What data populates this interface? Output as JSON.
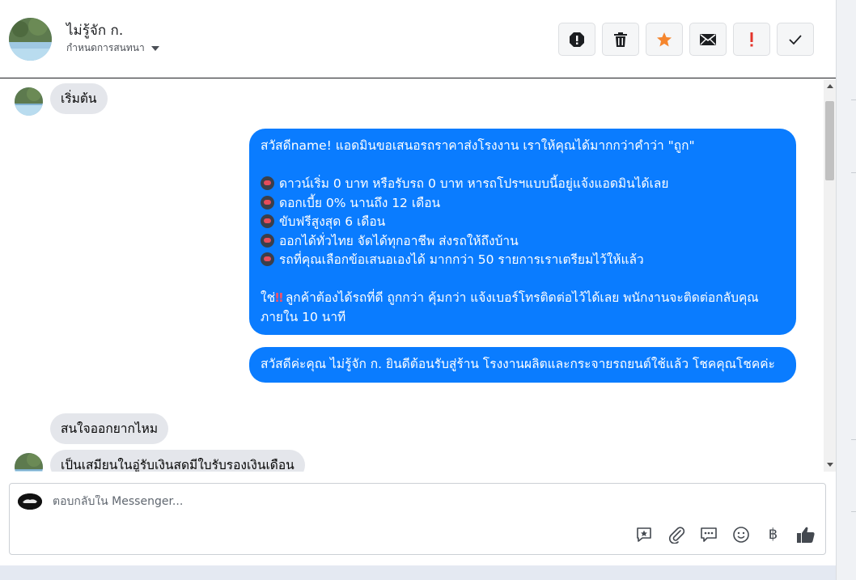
{
  "contact": {
    "name": "ไม่รู้จัก ก.",
    "assign_label": "กำหนดการสนทนา"
  },
  "actions": [
    {
      "name": "spam-icon",
      "color": "#1c1e21"
    },
    {
      "name": "trash-icon",
      "color": "#1c1e21"
    },
    {
      "name": "star-icon",
      "color": "#f5862e"
    },
    {
      "name": "mail-icon",
      "color": "#1c1e21"
    },
    {
      "name": "exclamation-icon",
      "color": "#e4342b"
    },
    {
      "name": "check-icon",
      "color": "#1c1e21"
    }
  ],
  "messages": {
    "m1": "เริ่มต้น",
    "m2": {
      "l1": "สวัสดีname! แอดมินขอเสนอรถราคาส่งโรงงาน เราให้คุณได้มากกว่าคำว่า \"ถูก\"",
      "l2": "ดาวน์เริ่ม 0 บาท หรือรับรถ 0 บาท หารถโปรฯแบบนี้อยู่แจ้งแอดมินได้เลย",
      "l3": "ดอกเบี้ย 0% นานถึง 12 เดือน",
      "l4": "ขับฟรีสูงสุด 6 เดือน",
      "l5": "ออกได้ทั่วไทย จัดได้ทุกอาชีพ ส่งรถให้ถึงบ้าน",
      "l6": "รถที่คุณเลือกข้อเสนอเองได้ มากกว่า 50 รายการเราเตรียมไว้ให้แล้ว",
      "l7a": "ใช่",
      "l7b": "ลูกค้าต้องได้รถที่ดี ถูกกว่า คุ้มกว่า แจ้งเบอร์โทรติดต่อไว้ได้เลย พนักงานจะติดต่อกลับคุณภายใน 10 นาที"
    },
    "m3": "สวัสดีค่ะคุณ ไม่รู้จัก ก. ยินดีต้อนรับสู่ร้าน โรงงานผลิตและกระจายรถยนต์ใช้แล้ว โชคคุณโชคค่ะ",
    "m4": "สนใจออกยากไหม",
    "m5": "เป็นเสมียนในอู่รับเงินสดมีใบรับรองเงินเดือน"
  },
  "composer": {
    "placeholder": "ตอบกลับใน Messenger...",
    "tools": [
      "saved-reply-icon",
      "attachment-icon",
      "chat-bubble-icon",
      "emoji-icon",
      "baht-icon",
      "like-icon"
    ],
    "baht_symbol": "฿"
  },
  "colors": {
    "outgoing": "#0a7cff",
    "incoming": "#e4e6eb"
  }
}
